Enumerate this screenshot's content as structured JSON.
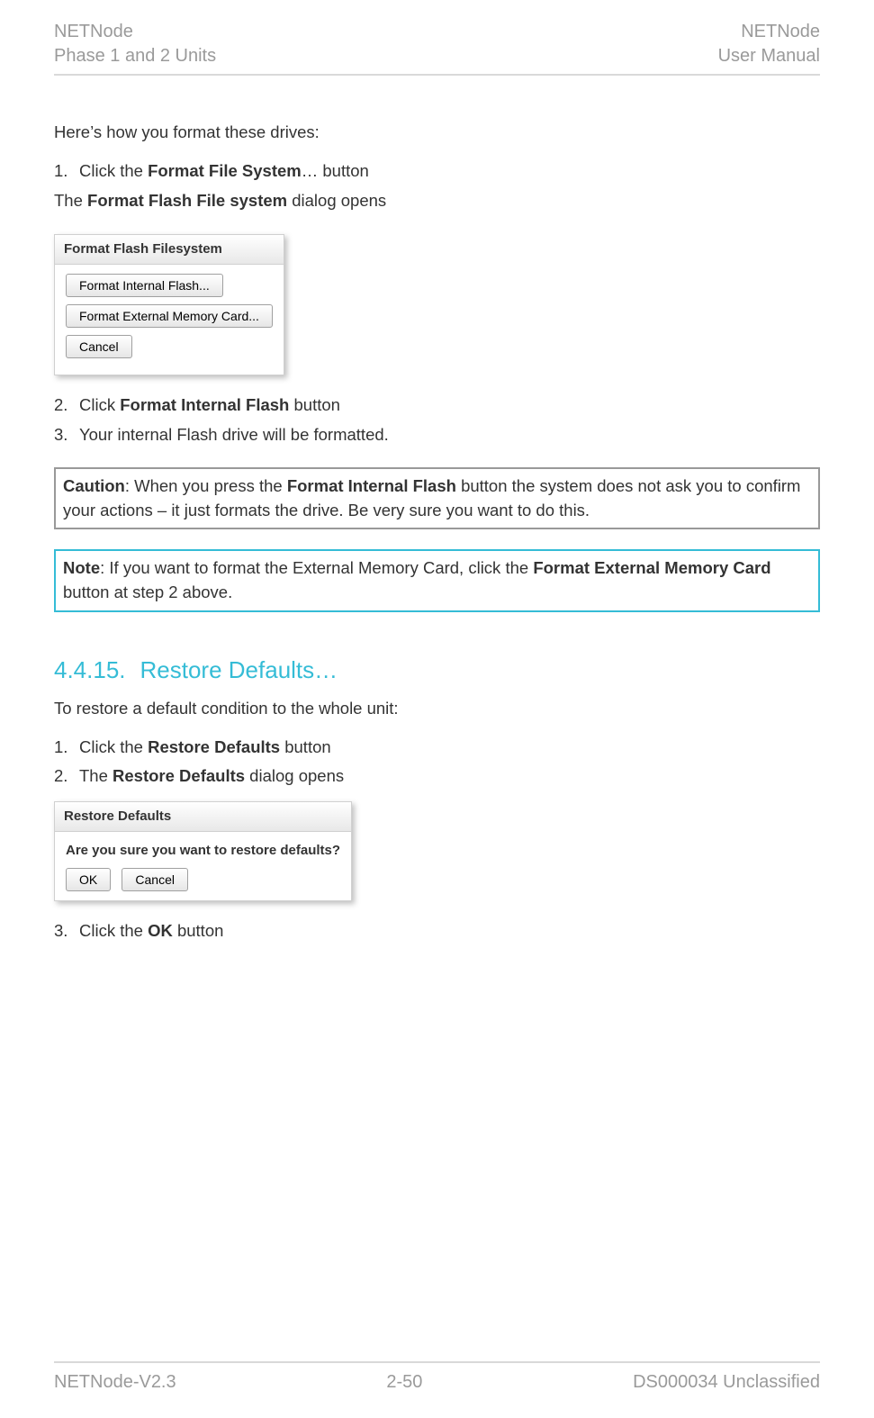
{
  "header": {
    "left_line1": "NETNode",
    "left_line2": "Phase 1 and 2 Units",
    "right_line1": "NETNode",
    "right_line2": "User Manual"
  },
  "intro": "Here’s how you format these drives:",
  "format_steps": {
    "s1_num": "1.",
    "s1_pre": "Click the ",
    "s1_bold": "Format File System",
    "s1_post": "… button",
    "s1b_pre": "The ",
    "s1b_bold": "Format Flash File system",
    "s1b_post": " dialog opens",
    "s2_num": "2.",
    "s2_pre": "Click ",
    "s2_bold": "Format Internal Flash",
    "s2_post": " button",
    "s3_num": "3.",
    "s3_text": "Your internal Flash drive will be formatted."
  },
  "dialog1": {
    "title": "Format Flash Filesystem",
    "btn_internal": "Format Internal Flash...",
    "btn_external": "Format External Memory Card...",
    "btn_cancel": "Cancel"
  },
  "caution": {
    "label": "Caution",
    "pre": ": When you press the ",
    "bold": "Format Internal Flash",
    "post": " button the system does not ask you to confirm your actions – it just formats the drive. Be very sure you want to do this."
  },
  "note": {
    "label": "Note",
    "pre": ": If you want to format the External Memory Card, click the ",
    "bold": "Format External Memory Card",
    "post": " button at step 2 above."
  },
  "section": {
    "num": "4.4.15.",
    "title": "Restore Defaults…"
  },
  "restore": {
    "intro": "To restore a default condition to the whole unit:",
    "s1_num": "1.",
    "s1_pre": "Click the ",
    "s1_bold": "Restore Defaults",
    "s1_post": " button",
    "s2_num": "2.",
    "s2_pre": "The ",
    "s2_bold": "Restore Defaults",
    "s2_post": " dialog opens",
    "s3_num": "3.",
    "s3_pre": "Click the ",
    "s3_bold": "OK",
    "s3_post": " button"
  },
  "dialog2": {
    "title": "Restore Defaults",
    "question": "Are you sure you want to restore defaults?",
    "ok": "OK",
    "cancel": "Cancel"
  },
  "footer": {
    "left": "NETNode-V2.3",
    "center": "2-50",
    "right": "DS000034 Unclassified"
  }
}
